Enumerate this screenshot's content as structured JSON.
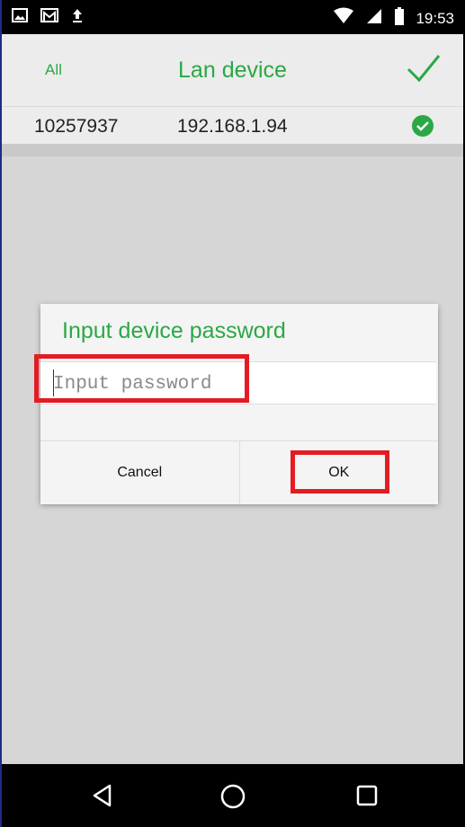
{
  "status_bar": {
    "time": "19:53",
    "left_icons": [
      "image-icon",
      "gmail-icon",
      "upload-icon"
    ],
    "right_icons": [
      "wifi-icon",
      "cell-signal-icon",
      "battery-icon"
    ]
  },
  "header": {
    "left_label": "All",
    "title": "Lan device",
    "right_icon": "checkmark-icon"
  },
  "device_list": [
    {
      "id": "10257937",
      "ip": "192.168.1.94",
      "status_icon": "check-circle-icon"
    }
  ],
  "dialog": {
    "title": "Input device password",
    "input_placeholder": "Input password",
    "input_value": "",
    "cancel_label": "Cancel",
    "ok_label": "OK"
  },
  "nav_bar": {
    "icons": [
      "back-icon",
      "home-icon",
      "recents-icon"
    ]
  },
  "colors": {
    "accent": "#2aa845",
    "highlight": "#e31c24",
    "background": "#d6d6d6"
  }
}
